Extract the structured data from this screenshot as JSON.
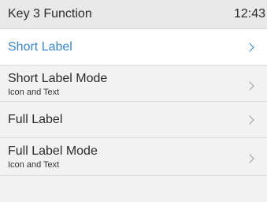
{
  "header": {
    "title": "Key 3 Function",
    "time": "12:43"
  },
  "menu": {
    "items": [
      {
        "label": "Short Label",
        "sublabel": "",
        "selected": true,
        "icon": "chevron-right-icon"
      },
      {
        "label": "Short Label Mode",
        "sublabel": "Icon and Text",
        "selected": false,
        "icon": "chevron-right-icon"
      },
      {
        "label": "Full Label",
        "sublabel": "",
        "selected": false,
        "icon": "chevron-right-icon"
      },
      {
        "label": "Full Label Mode",
        "sublabel": "Icon and Text",
        "selected": false,
        "icon": "chevron-right-icon"
      }
    ]
  },
  "colors": {
    "accent": "#3a86c8",
    "background": "#f2f2f2",
    "header": "#e9e9e9",
    "selected_row": "#ffffff"
  }
}
